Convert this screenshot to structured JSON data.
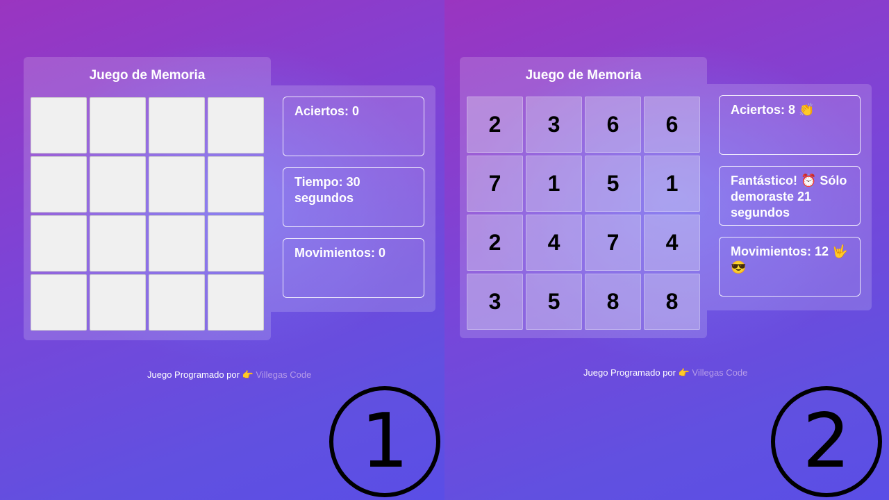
{
  "panels": [
    {
      "title": "Juego de Memoria",
      "cards": [
        "",
        "",
        "",
        "",
        "",
        "",
        "",
        "",
        "",
        "",
        "",
        "",
        "",
        "",
        "",
        ""
      ],
      "stats": {
        "aciertos": "Aciertos: 0",
        "tiempo": "Tiempo: 30 segundos",
        "movimientos": "Movimientos: 0"
      },
      "footer": {
        "text": "Juego Programado por 👉 ",
        "author": "Villegas Code"
      },
      "badge": "1"
    },
    {
      "title": "Juego de Memoria",
      "cards": [
        "2",
        "3",
        "6",
        "6",
        "7",
        "1",
        "5",
        "1",
        "2",
        "4",
        "7",
        "4",
        "3",
        "5",
        "8",
        "8"
      ],
      "stats": {
        "aciertos": "Aciertos: 8 👏",
        "tiempo": "Fantástico! ⏰ Sólo demoraste 21 segundos",
        "movimientos": "Movimientos: 12 🤟😎"
      },
      "footer": {
        "text": "Juego Programado por 👉 ",
        "author": "Villegas Code"
      },
      "badge": "2"
    }
  ],
  "colors": {
    "background": "#7b46d6",
    "card_face_down": "#f0f0f0",
    "card_text": "#000000",
    "author_link": "#b59be8"
  }
}
